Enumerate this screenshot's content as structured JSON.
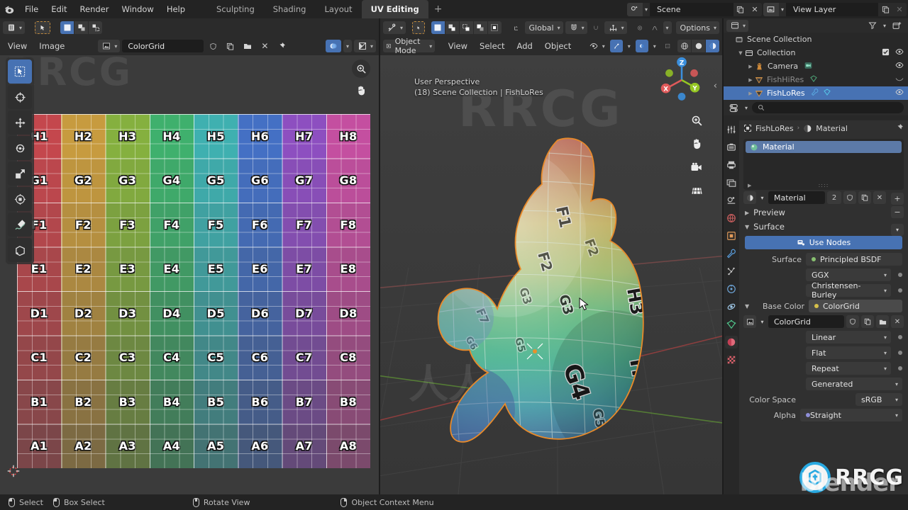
{
  "topbar": {
    "logo_icon": "blender-logo-icon",
    "menus": [
      "File",
      "Edit",
      "Render",
      "Window",
      "Help"
    ],
    "workspaces": [
      {
        "label": "Sculpting",
        "active": false
      },
      {
        "label": "Shading",
        "active": false
      },
      {
        "label": "Layout",
        "active": false
      },
      {
        "label": "UV Editing",
        "active": true
      }
    ],
    "add_workspace": "+",
    "scene": {
      "icon": "scene-icon",
      "value": "Scene",
      "copy_icon": "duplicate-icon",
      "close_icon": "close-icon"
    },
    "view_layer": {
      "icon": "view-layer-icon",
      "value": "View Layer",
      "copy_icon": "duplicate-icon",
      "close_icon": "close-icon"
    }
  },
  "uv_editor": {
    "toolbar_row": {
      "editor_type_icon": "uv-editor-icon",
      "tweak_icon": "tweak-cursor-icon",
      "select_modes": [
        "select-box-icon",
        "select-face-icon",
        "select-island-icon"
      ]
    },
    "header": {
      "menus": [
        "View",
        "Image"
      ],
      "image_icon": "image-data-icon",
      "image_name": "ColorGrid",
      "fake_user_icon": "shield-icon",
      "new_image_icon": "duplicate-icon",
      "open_image_icon": "folder-icon",
      "unlink_icon": "close-icon",
      "pin_icon": "pin-icon",
      "display_channel_icon": "display-channels-icon",
      "overlay_icon": "uv-overlay-icon"
    },
    "tools": [
      {
        "name": "tweak-tool",
        "active": true
      },
      {
        "name": "cursor-tool",
        "active": false
      },
      {
        "name": "move-tool",
        "active": false
      },
      {
        "name": "rotate-tool",
        "active": false
      },
      {
        "name": "scale-tool",
        "active": false
      },
      {
        "name": "transform-tool",
        "active": false
      },
      {
        "name": "annotate-tool",
        "active": false
      },
      {
        "name": "uv-rip-tool",
        "active": false
      }
    ],
    "zoom_icon": "zoom-in-icon",
    "pan_icon": "hand-pan-icon",
    "cursor2d_icon": "2d-cursor-icon"
  },
  "color_grid": {
    "rows": [
      "H",
      "G",
      "F",
      "E",
      "D",
      "C",
      "B",
      "A"
    ],
    "cols": [
      "1",
      "2",
      "3",
      "4",
      "5",
      "6",
      "7",
      "8"
    ],
    "column_colors": [
      "#c4474d",
      "#c79b3f",
      "#85b03f",
      "#3fb06d",
      "#3fb0b0",
      "#4470c4",
      "#8d4fc0",
      "#c44fa0"
    ],
    "row_brightness": [
      1.0,
      0.93,
      0.86,
      0.78,
      0.7,
      0.62,
      0.52,
      0.42
    ],
    "labels": [
      [
        "H1",
        "H2",
        "H3",
        "H4",
        "H5",
        "H6",
        "H7",
        "H8"
      ],
      [
        "G1",
        "G2",
        "G3",
        "G4",
        "G5",
        "G6",
        "G7",
        "G8"
      ],
      [
        "F1",
        "F2",
        "F3",
        "F4",
        "F5",
        "F6",
        "F7",
        "F8"
      ],
      [
        "E1",
        "E2",
        "E3",
        "E4",
        "E5",
        "E6",
        "E7",
        "E8"
      ],
      [
        "D1",
        "D2",
        "D3",
        "D4",
        "D5",
        "D6",
        "D7",
        "D8"
      ],
      [
        "C1",
        "C2",
        "C3",
        "C4",
        "C5",
        "C6",
        "C7",
        "C8"
      ],
      [
        "B1",
        "B2",
        "B3",
        "B4",
        "B5",
        "B6",
        "B7",
        "B8"
      ],
      [
        "A1",
        "A2",
        "A3",
        "A4",
        "A5",
        "A6",
        "A7",
        "A8"
      ]
    ]
  },
  "viewport": {
    "header_top": {
      "snap_icon": "snap-increment-icon",
      "tweak_icon": "tweak-cursor-icon",
      "select_modes": [
        "select-set-icon",
        "select-extend-icon",
        "select-subtract-icon",
        "select-invert-icon",
        "select-intersect-icon"
      ],
      "transform_orientation_icon": "orientation-icon",
      "transform_orientation": "Global",
      "snapping_magnet_icon": "magnet-icon",
      "proportional_icon": "proportional-edit-icon",
      "falloff_icon": "falloff-curve-icon",
      "options_label": "Options"
    },
    "header_bottom": {
      "mode_icon": "object-mode-icon",
      "mode": "Object Mode",
      "menus": [
        "View",
        "Select",
        "Add",
        "Object"
      ],
      "visibility_icon": "show-hide-icon",
      "gizmo_icon": "gizmo-icon",
      "overlays_icon": "overlays-icon",
      "xray_icon": "xray-icon",
      "shading_modes": [
        "wireframe-shading-icon",
        "solid-shading-icon",
        "material-preview-icon"
      ]
    },
    "info_line1": "User Perspective",
    "info_line2": "(18) Scene Collection | FishLoRes",
    "gizmo_axes": [
      {
        "label": "X",
        "color": "#e05a5a"
      },
      {
        "label": "Y",
        "color": "#95c623"
      },
      {
        "label": "Z",
        "color": "#3b8fdd"
      }
    ],
    "nav_buttons": [
      "zoom-view-icon",
      "pan-view-icon",
      "camera-view-icon",
      "toggle-perspective-icon"
    ],
    "object_label": "FishLoRes",
    "cursor_icon": "mouse-pointer-icon"
  },
  "outliner": {
    "display_mode_icon": "outliner-display-icon",
    "filter_icon": "filter-icon",
    "new_collection_icon": "new-collection-icon",
    "search_placeholder": "",
    "search_icon": "search-icon",
    "rows": [
      {
        "label": "Scene Collection",
        "icon": "scene-collection-icon",
        "indent": 0,
        "selected": false,
        "expander": "",
        "checkbox": false,
        "eye": false
      },
      {
        "label": "Collection",
        "icon": "collection-icon",
        "indent": 1,
        "selected": false,
        "expander": "down",
        "checkbox": true,
        "eye": true
      },
      {
        "label": "Camera",
        "icon": "camera-object-icon",
        "indent": 2,
        "selected": false,
        "expander": "right",
        "checkbox": false,
        "eye": true
      },
      {
        "label": "FishHiRes",
        "icon": "mesh-object-icon",
        "indent": 2,
        "selected": false,
        "expander": "right",
        "checkbox": false,
        "eye": false,
        "dimmed": true
      },
      {
        "label": "FishLoRes",
        "icon": "mesh-object-icon",
        "indent": 2,
        "selected": true,
        "expander": "right",
        "checkbox": false,
        "eye": true
      }
    ]
  },
  "properties": {
    "tabs": [
      {
        "name": "tool-tab",
        "icon": "tool-icon",
        "active": false
      },
      {
        "name": "render-tab",
        "icon": "render-icon",
        "active": false
      },
      {
        "name": "output-tab",
        "icon": "printer-icon",
        "active": false
      },
      {
        "name": "view-layer-tab",
        "icon": "images-icon",
        "active": false
      },
      {
        "name": "scene-tab",
        "icon": "scene-props-icon",
        "active": false
      },
      {
        "name": "world-tab",
        "icon": "world-icon",
        "active": false
      },
      {
        "name": "object-tab",
        "icon": "object-props-icon",
        "active": false
      },
      {
        "name": "modifier-tab",
        "icon": "wrench-icon",
        "active": false
      },
      {
        "name": "particles-tab",
        "icon": "particles-icon",
        "active": false
      },
      {
        "name": "physics-tab",
        "icon": "physics-icon",
        "active": false
      },
      {
        "name": "constraints-tab",
        "icon": "constraints-icon",
        "active": false
      },
      {
        "name": "data-tab",
        "icon": "mesh-data-icon",
        "active": false
      },
      {
        "name": "material-tab",
        "icon": "material-icon",
        "active": true
      },
      {
        "name": "texture-tab",
        "icon": "texture-icon",
        "active": false
      }
    ],
    "breadcrumb": {
      "object_icon": "object-props-icon",
      "object": "FishLoRes",
      "sep": "›",
      "material_icon": "material-icon",
      "material": "Material",
      "pin_icon": "pin-icon"
    },
    "slot_list": [
      {
        "label": "Material",
        "icon": "material-sphere-icon",
        "selected": true
      }
    ],
    "slot_buttons": [
      "plus-icon",
      "minus-icon",
      "chevron-down-icon"
    ],
    "material_row": {
      "browse_icon": "browse-material-icon",
      "name": "Material",
      "users": "2",
      "fake_user_icon": "shield-icon",
      "new_icon": "duplicate-icon",
      "unlink_icon": "close-icon",
      "data_icon": "mesh-data-icon"
    },
    "preview_panel": "Preview",
    "surface_panel": "Surface",
    "use_nodes_label": "Use Nodes",
    "use_nodes_icon": "nodes-icon",
    "surface_label": "Surface",
    "surface_value": "Principled BSDF",
    "distribution": "GGX",
    "subsurface_method": "Christensen-Burley",
    "base_color_label": "Base Color",
    "base_color_value": "ColorGrid",
    "texture_row": {
      "icon": "image-data-icon",
      "name": "ColorGrid",
      "fake_user_icon": "shield-icon",
      "new_icon": "duplicate-icon",
      "open_icon": "folder-icon",
      "unlink_icon": "close-icon"
    },
    "interpolation": "Linear",
    "projection": "Flat",
    "extension": "Repeat",
    "source": "Generated",
    "color_space_label": "Color Space",
    "color_space": "sRGB",
    "alpha_label": "Alpha",
    "alpha_value": "Straight"
  },
  "status_bar": [
    {
      "icon": "mouse-left-icon",
      "label": "Select"
    },
    {
      "icon": "mouse-right-drag-icon",
      "label": "Box Select"
    },
    {
      "icon": "mouse-middle-icon",
      "label": "Rotate View"
    },
    {
      "icon": "mouse-right-icon",
      "label": "Object Context Menu"
    }
  ],
  "watermarks": {
    "rrcg": "RRCG",
    "cn": "人人素材",
    "blender": "blender"
  }
}
